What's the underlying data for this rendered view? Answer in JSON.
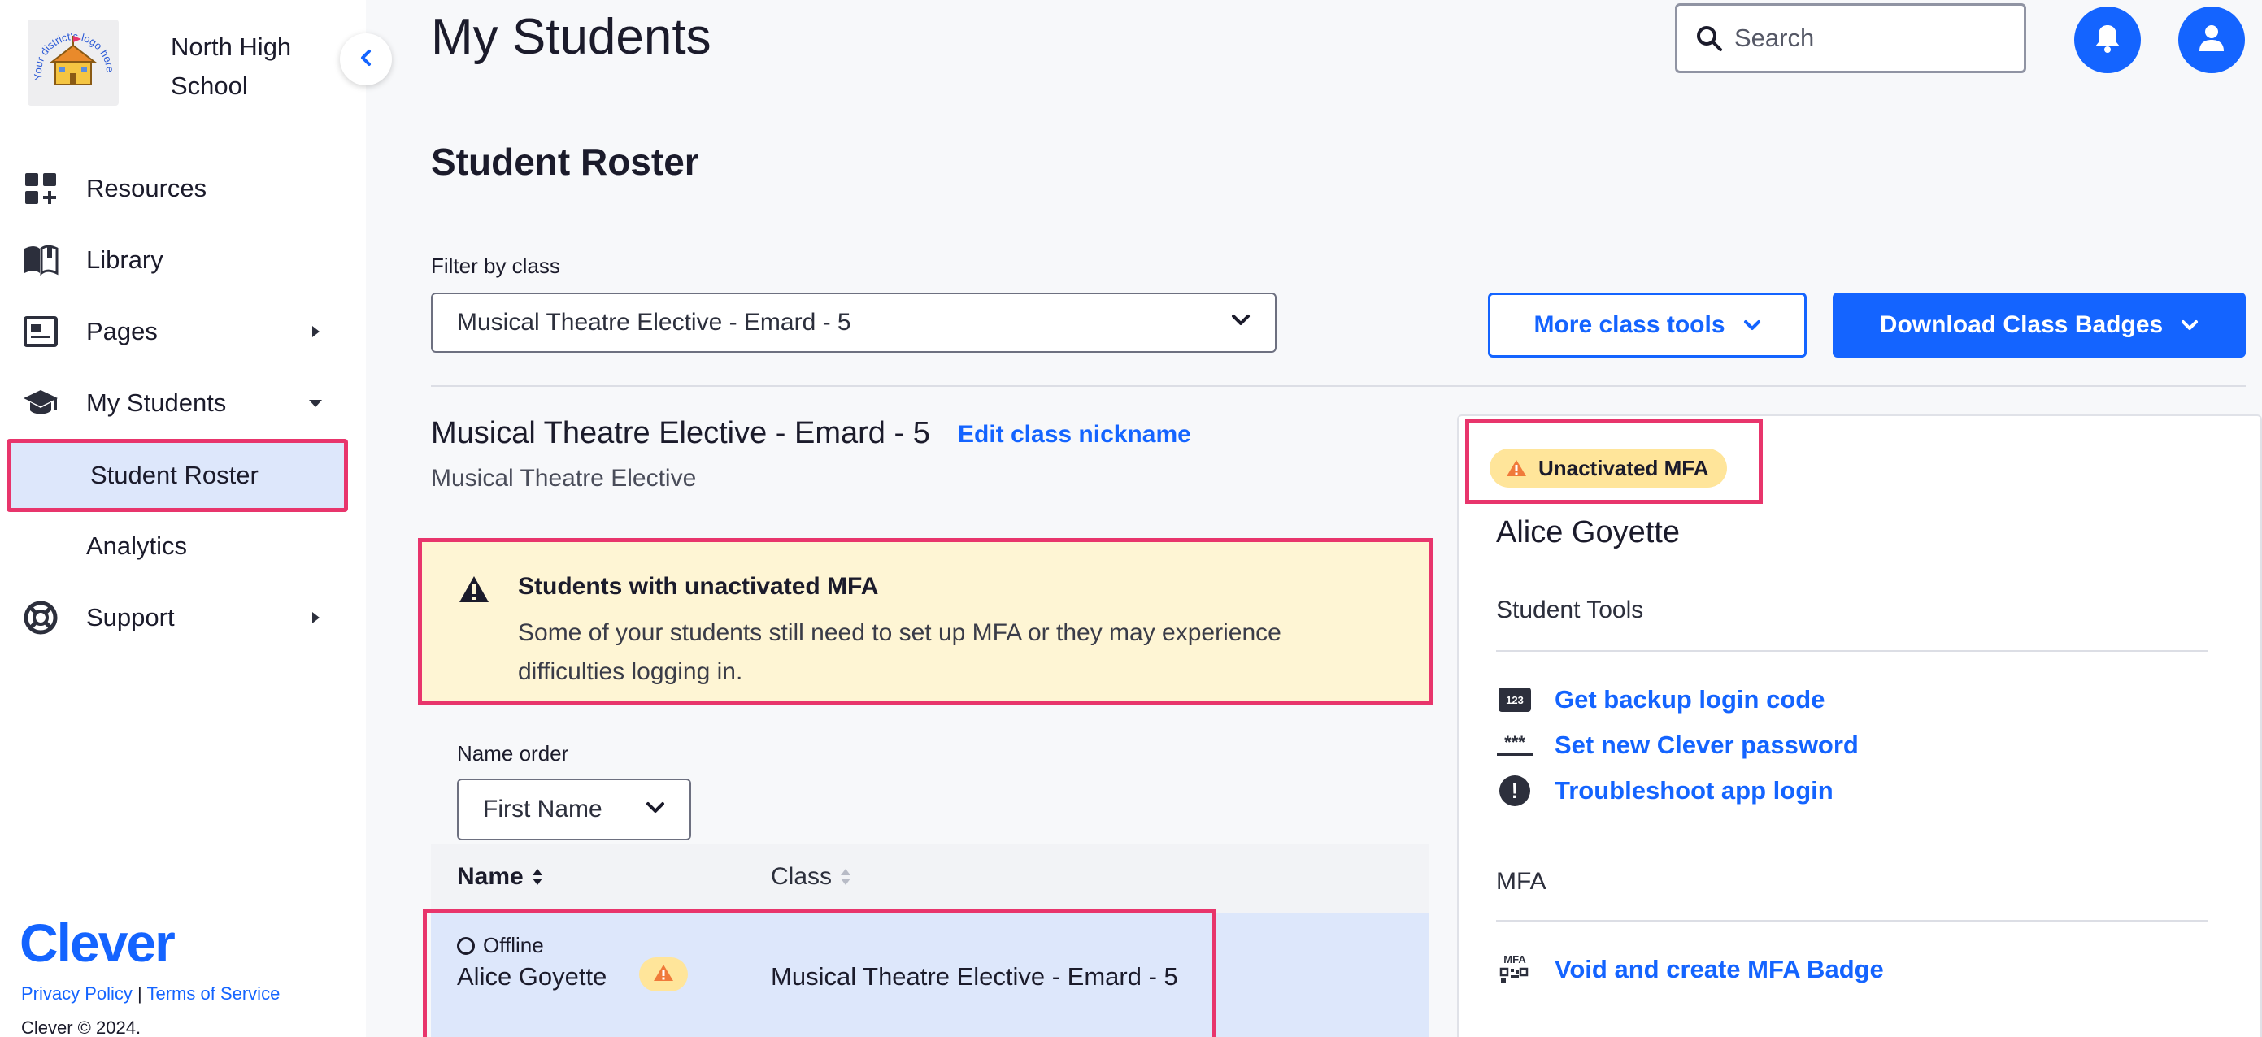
{
  "sidebar": {
    "district_logo_text": "Your district's logo here",
    "school_name": "North High School",
    "items": [
      {
        "label": "Resources"
      },
      {
        "label": "Library"
      },
      {
        "label": "Pages"
      },
      {
        "label": "My Students"
      },
      {
        "label": "Student Roster"
      },
      {
        "label": "Analytics"
      },
      {
        "label": "Support"
      }
    ],
    "brand": "Clever",
    "footer": {
      "privacy": "Privacy Policy",
      "separator": "|",
      "terms": "Terms of Service",
      "copyright": "Clever © 2024."
    }
  },
  "header": {
    "title": "My Students",
    "search_placeholder": "Search"
  },
  "main": {
    "section_title": "Student Roster",
    "filter_label": "Filter by class",
    "selected_class": "Musical Theatre Elective - Emard - 5",
    "more_tools_label": "More class tools",
    "download_label": "Download Class Badges",
    "class_heading": "Musical Theatre Elective - Emard - 5",
    "edit_nickname": "Edit class nickname",
    "class_subtitle": "Musical Theatre Elective",
    "alert": {
      "title": "Students with unactivated MFA",
      "body": "Some of your students still need to set up MFA or they may experience difficulties logging in."
    },
    "name_order_label": "Name order",
    "name_order_value": "First Name",
    "table": {
      "columns": [
        "Name",
        "Class"
      ],
      "rows": [
        {
          "status": "Offline",
          "name": "Alice Goyette",
          "class": "Musical Theatre Elective - Emard - 5"
        }
      ]
    }
  },
  "detail": {
    "badge": "Unactivated MFA",
    "student_name": "Alice Goyette",
    "tools_heading": "Student Tools",
    "tools": [
      {
        "icon": "number-code-icon",
        "icon_text": "123",
        "label": "Get backup login code"
      },
      {
        "icon": "password-icon",
        "icon_text": "***",
        "label": "Set new Clever password"
      },
      {
        "icon": "alert-circle-icon",
        "icon_text": "!",
        "label": "Troubleshoot app login"
      }
    ],
    "mfa_heading": "MFA",
    "mfa_icon_text": "MFA",
    "mfa_link": "Void and create MFA Badge"
  },
  "colors": {
    "accent": "#1464ff",
    "highlight": "#e8356c",
    "alert_bg": "#fef5d4",
    "badge_bg": "#ffe59a",
    "selected_bg": "#dde7fb"
  }
}
